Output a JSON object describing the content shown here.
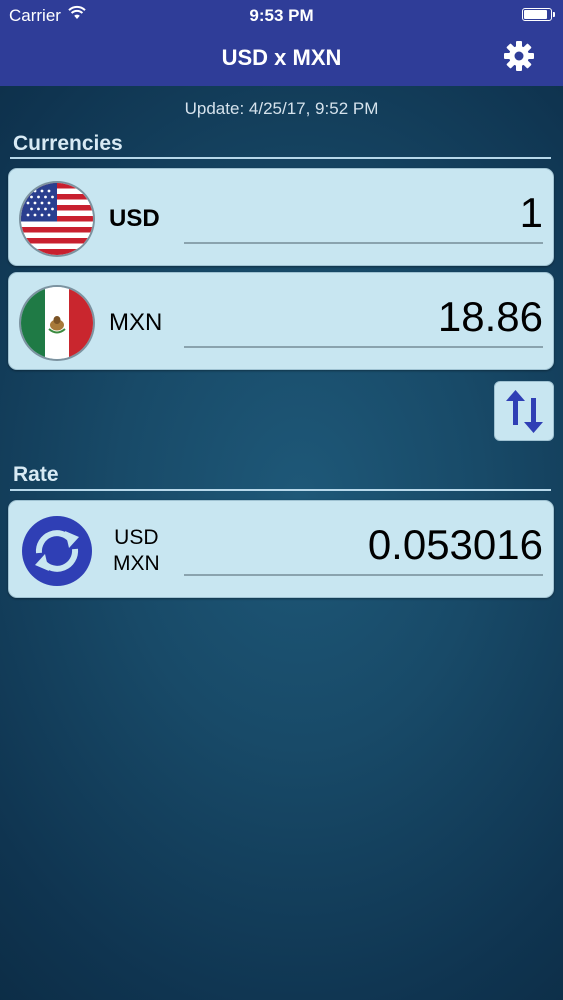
{
  "status_bar": {
    "carrier": "Carrier",
    "time": "9:53 PM",
    "battery_level": 0.95
  },
  "nav": {
    "title": "USD x MXN",
    "settings_icon": "gear-icon"
  },
  "update_text": "Update: 4/25/17, 9:52 PM",
  "sections": {
    "currencies": "Currencies",
    "rate": "Rate"
  },
  "currencies": [
    {
      "code": "USD",
      "value": "1",
      "flag_icon": "us-flag-icon"
    },
    {
      "code": "MXN",
      "value": "18.86",
      "flag_icon": "mexico-flag-icon"
    }
  ],
  "rate": {
    "from": "USD",
    "to": "MXN",
    "value": "0.053016",
    "icon": "refresh-icon"
  },
  "colors": {
    "nav_bar": "#2f3d98",
    "card": "#c8e6f1",
    "icon_blue": "#2f3fb5"
  }
}
